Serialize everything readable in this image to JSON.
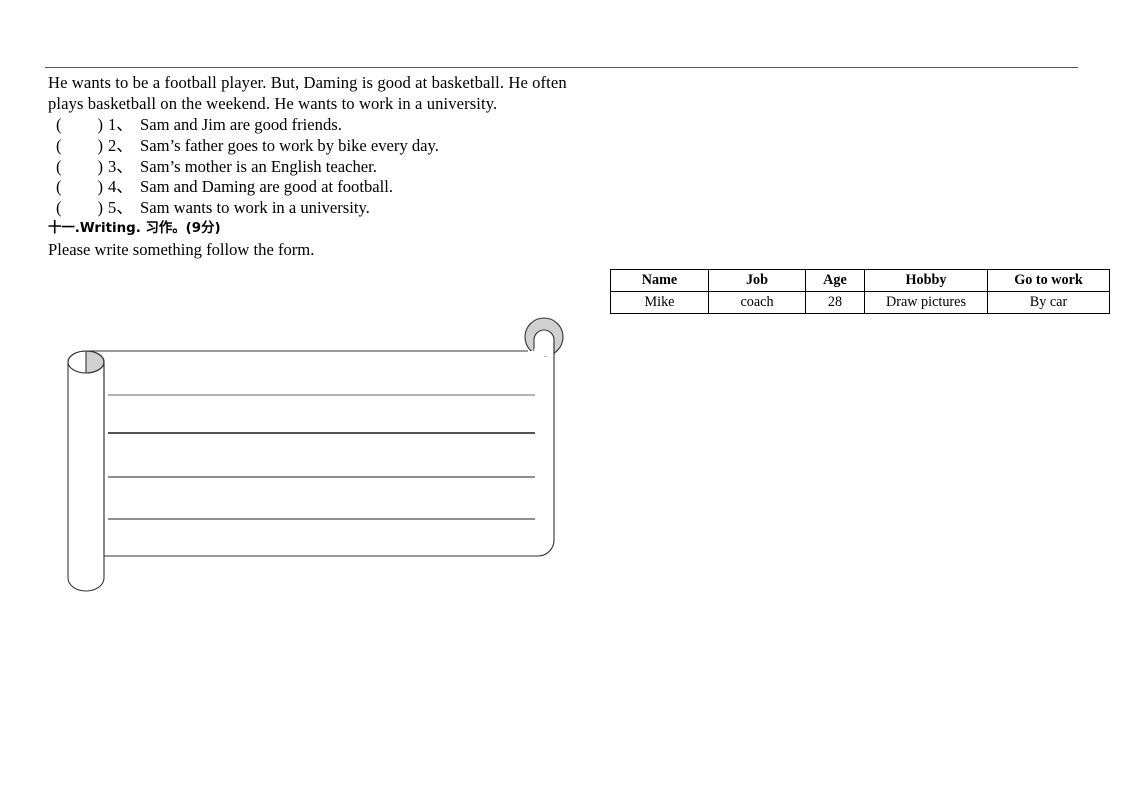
{
  "page": {
    "background_color": "#ffffff",
    "rule_color": "#555555"
  },
  "passage": {
    "lines": [
      "He wants to be a football player. But, Daming is good at basketball. He often",
      "plays basketball on the weekend. He wants to work in a university."
    ]
  },
  "statements": {
    "bracket_open": "(",
    "bracket_close": ")",
    "items": [
      {
        "num": "1、",
        "text": "Sam and Jim are good friends."
      },
      {
        "num": "2、",
        "text": "Sam’s father goes to work by bike every day."
      },
      {
        "num": "3、",
        "text": "Sam’s mother is an English teacher."
      },
      {
        "num": "4、",
        "text": "Sam and Daming are good at football."
      },
      {
        "num": "5、",
        "text": "Sam wants to work in a university."
      }
    ]
  },
  "section": {
    "heading": "十一.Writing. 习作。(9分)",
    "instruction": "Please write something follow the form."
  },
  "info_table": {
    "headers": [
      "Name",
      "Job",
      "Age",
      "Hobby",
      "Go to work"
    ],
    "rows": [
      [
        "Mike",
        "coach",
        "28",
        "Draw pictures",
        "By car"
      ]
    ]
  },
  "scroll": {
    "roll_fill": "#d0d0d0",
    "stroke": "#333333",
    "line_count": 4,
    "line_colors": [
      "#9a9a9a",
      "#1c1c1c",
      "#4a4a4a",
      "#4a4a4a"
    ]
  }
}
